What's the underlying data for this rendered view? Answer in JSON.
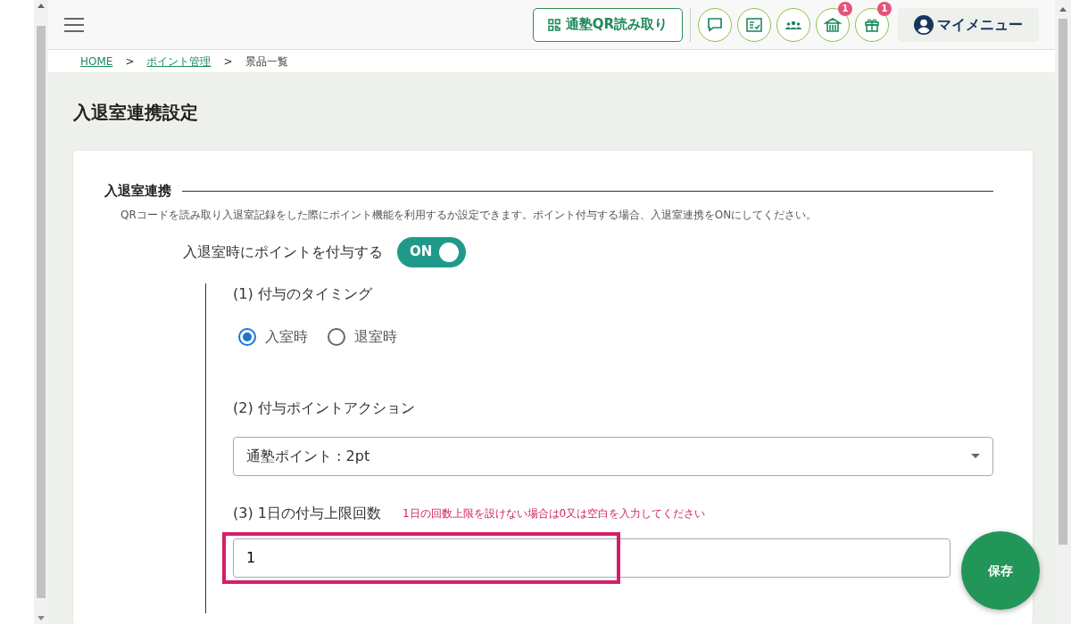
{
  "header": {
    "qr_button": "通塾QR読み取り",
    "icon_buttons": [
      {
        "kind": "chat"
      },
      {
        "kind": "checklist"
      },
      {
        "kind": "group"
      },
      {
        "kind": "shop",
        "badge": "1"
      },
      {
        "kind": "gift",
        "badge": "1"
      }
    ],
    "my_menu": "マイメニュー"
  },
  "breadcrumb": [
    {
      "label": "HOME",
      "link": true
    },
    {
      "label": "ポイント管理",
      "link": true
    },
    {
      "label": "景品一覧",
      "link": false
    }
  ],
  "breadcrumb_separator": ">",
  "page_title": "入退室連携設定",
  "section": {
    "title": "入退室連携",
    "description": "QRコードを読み取り入退室記録をした際にポイント機能を利用するか設定できます。ポイント付与する場合、入退室連携をONにしてください。",
    "toggle": {
      "label": "入退室時にポイントを付与する",
      "on": true,
      "text": "ON"
    },
    "timing": {
      "label": "(1) 付与のタイミング",
      "options": [
        {
          "label": "入室時",
          "selected": true
        },
        {
          "label": "退室時",
          "selected": false
        }
      ]
    },
    "action": {
      "label": "(2) 付与ポイントアクション",
      "value": "通塾ポイント : 2pt"
    },
    "limit": {
      "label": "(3) 1日の付与上限回数",
      "hint": "1日の回数上限を設けない場合は0又は空白を入力してください",
      "value": "1",
      "highlighted": true
    }
  },
  "save_button": "保存"
}
